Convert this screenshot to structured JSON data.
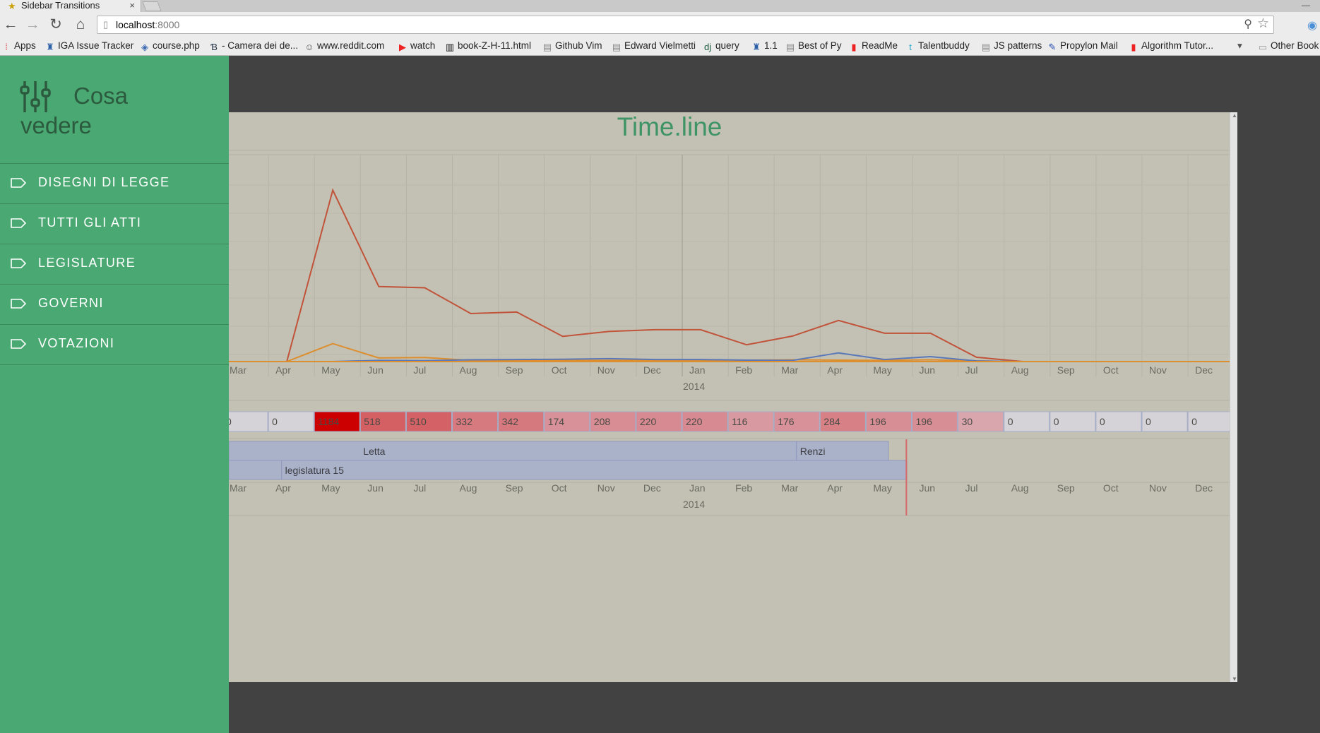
{
  "browser": {
    "tab_title": "Sidebar Transitions",
    "url_host": "localhost",
    "url_port": ":8000",
    "bookmarks": [
      "Apps",
      "IGA Issue Tracker",
      "course.php",
      "- Camera dei de...",
      "www.reddit.com",
      "watch",
      "book-Z-H-11.html",
      "Github Vim",
      "Edward Vielmetti",
      "query",
      "1.1",
      "Best of Py",
      "ReadMe",
      "Talentbuddy",
      "JS patterns",
      "Propylon Mail",
      "Algorithm Tutor...",
      "Other Book"
    ]
  },
  "sidebar": {
    "brand": "Cosa vedere",
    "items": [
      {
        "label": "DISEGNI DI LEGGE"
      },
      {
        "label": "TUTTI GLI ATTI"
      },
      {
        "label": "LEGISLATURE"
      },
      {
        "label": "GOVERNI"
      },
      {
        "label": "VOTAZIONI"
      }
    ]
  },
  "main": {
    "title": "Time.line"
  },
  "colors": {
    "sidebar": "#4aa972",
    "panel": "#c3c1b3",
    "title": "#3f9466",
    "series_red": "#c1533a",
    "series_orange": "#dd8e2e",
    "series_blue": "#5a78b8",
    "band": "#aab2ca",
    "now_line": "#d46a6a"
  },
  "chart_data": {
    "type": "line",
    "title": "Time.line",
    "x": [
      "Mar",
      "Apr",
      "May",
      "Jun",
      "Jul",
      "Aug",
      "Sep",
      "Oct",
      "Nov",
      "Dec",
      "Jan",
      "Feb",
      "Mar",
      "Apr",
      "May",
      "Jun",
      "Jul",
      "Aug",
      "Sep",
      "Oct",
      "Nov",
      "Dec"
    ],
    "year_marker": {
      "label": "2014",
      "at": "Jan"
    },
    "ylim": [
      0,
      1200
    ],
    "grid": true,
    "series": [
      {
        "color": "#c1533a",
        "values": [
          0,
          0,
          1184,
          518,
          510,
          332,
          342,
          174,
          208,
          220,
          220,
          116,
          176,
          284,
          196,
          196,
          30,
          0,
          0,
          0,
          0,
          0
        ]
      },
      {
        "color": "#dd8e2e",
        "values": [
          0,
          0,
          124,
          25,
          28,
          8,
          8,
          8,
          8,
          8,
          8,
          10,
          12,
          10,
          8,
          12,
          5,
          0,
          0,
          0,
          0,
          0
        ]
      },
      {
        "color": "#5a78b8",
        "values": [
          0,
          0,
          0,
          8,
          6,
          12,
          14,
          16,
          20,
          14,
          14,
          10,
          8,
          60,
          14,
          34,
          4,
          0,
          0,
          0,
          0,
          0
        ]
      }
    ],
    "heatmap_values": [
      0,
      0,
      1184,
      518,
      510,
      332,
      342,
      174,
      208,
      220,
      220,
      116,
      176,
      284,
      196,
      196,
      30,
      0,
      0,
      0,
      0,
      0
    ],
    "bands": [
      {
        "label": "Letta",
        "start": 3,
        "end": 12.5
      },
      {
        "label": "Renzi",
        "start": 12.5,
        "end": 14.5
      },
      {
        "label": "legislatura 15",
        "start": 1.3,
        "end": 14.9
      }
    ]
  }
}
